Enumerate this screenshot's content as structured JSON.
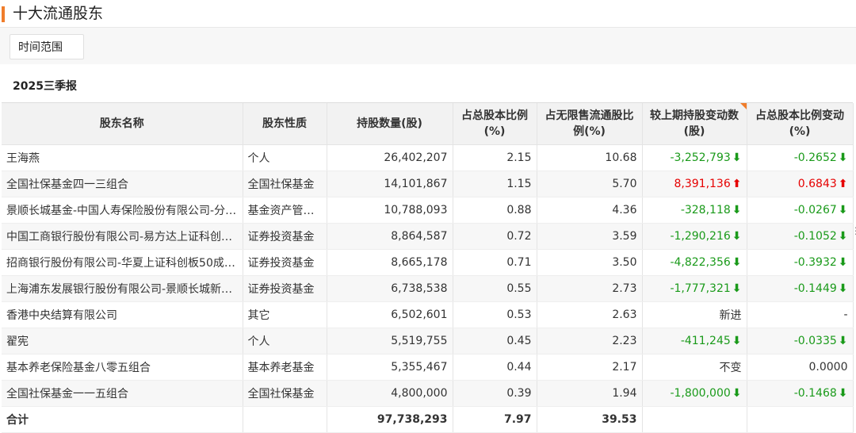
{
  "header": {
    "title": "十大流通股东"
  },
  "filter": {
    "time_range_label": "时间范围"
  },
  "report": {
    "period": "2025三季报"
  },
  "table": {
    "columns": [
      "股东名称",
      "股东性质",
      "持股数量(股)",
      "占总股本比例(%)",
      "占无限售流通股比例(%)",
      "较上期持股变动数(股)",
      "占总股本比例变动(%)"
    ],
    "rows": [
      {
        "name": "王海燕",
        "type": "个人",
        "shares": "26,402,207",
        "pct_total": "2.15",
        "pct_float": "10.68",
        "change": "-3,252,793",
        "change_pct": "-0.2652",
        "direction": "down"
      },
      {
        "name": "全国社保基金四一三组合",
        "type": "全国社保基金",
        "shares": "14,101,867",
        "pct_total": "1.15",
        "pct_float": "5.70",
        "change": "8,391,136",
        "change_pct": "0.6843",
        "direction": "up"
      },
      {
        "name": "景顺长城基金-中国人寿保险股份有限公司-分…",
        "type": "基金资产管…",
        "shares": "10,788,093",
        "pct_total": "0.88",
        "pct_float": "4.36",
        "change": "-328,118",
        "change_pct": "-0.0267",
        "direction": "down"
      },
      {
        "name": "中国工商银行股份有限公司-易方达上证科创…",
        "type": "证券投资基金",
        "shares": "8,864,587",
        "pct_total": "0.72",
        "pct_float": "3.59",
        "change": "-1,290,216",
        "change_pct": "-0.1052",
        "direction": "down"
      },
      {
        "name": "招商银行股份有限公司-华夏上证科创板50成…",
        "type": "证券投资基金",
        "shares": "8,665,178",
        "pct_total": "0.71",
        "pct_float": "3.50",
        "change": "-4,822,356",
        "change_pct": "-0.3932",
        "direction": "down"
      },
      {
        "name": "上海浦东发展银行股份有限公司-景顺长城新…",
        "type": "证券投资基金",
        "shares": "6,738,538",
        "pct_total": "0.55",
        "pct_float": "2.73",
        "change": "-1,777,321",
        "change_pct": "-0.1449",
        "direction": "down"
      },
      {
        "name": "香港中央结算有限公司",
        "type": "其它",
        "shares": "6,502,601",
        "pct_total": "0.53",
        "pct_float": "2.63",
        "change": "新进",
        "change_pct": "-",
        "direction": "none"
      },
      {
        "name": "翟宪",
        "type": "个人",
        "shares": "5,519,755",
        "pct_total": "0.45",
        "pct_float": "2.23",
        "change": "-411,245",
        "change_pct": "-0.0335",
        "direction": "down"
      },
      {
        "name": "基本养老保险基金八零五组合",
        "type": "基本养老基金",
        "shares": "5,355,467",
        "pct_total": "0.44",
        "pct_float": "2.17",
        "change": "不变",
        "change_pct": "0.0000",
        "direction": "none"
      },
      {
        "name": "全国社保基金一一五组合",
        "type": "全国社保基金",
        "shares": "4,800,000",
        "pct_total": "0.39",
        "pct_float": "1.94",
        "change": "-1,800,000",
        "change_pct": "-0.1468",
        "direction": "down"
      }
    ],
    "total": {
      "label": "合计",
      "shares": "97,738,293",
      "pct_total": "7.97",
      "pct_float": "39.53"
    }
  },
  "colors": {
    "up": "#e60000",
    "down": "#1a9a1a",
    "accent": "#f07d2b"
  },
  "icons": {
    "up": "arrow-up-icon",
    "down": "arrow-down-icon"
  }
}
